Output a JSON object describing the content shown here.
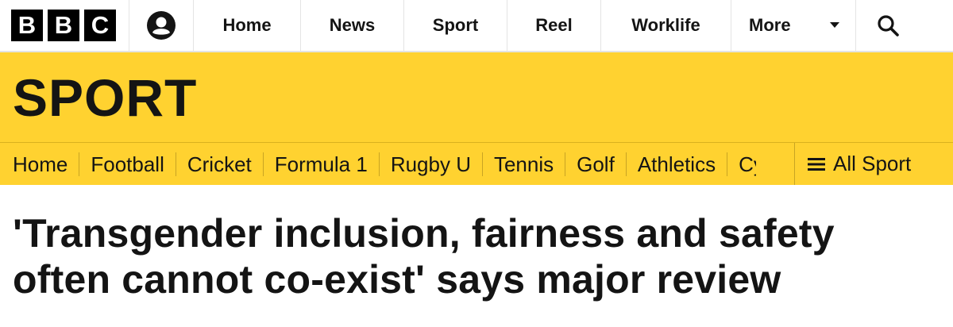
{
  "topbar": {
    "logo_letters": [
      "B",
      "B",
      "C"
    ],
    "account_icon": "user-icon",
    "nav": [
      {
        "label": "Home"
      },
      {
        "label": "News"
      },
      {
        "label": "Sport"
      },
      {
        "label": "Reel"
      },
      {
        "label": "Worklife"
      }
    ],
    "more_label": "More",
    "more_icon": "chevron-down-icon",
    "search_icon": "search-icon"
  },
  "masthead": {
    "title": "SPORT",
    "background": "#ffd230"
  },
  "subnav": {
    "items": [
      {
        "label": "Home"
      },
      {
        "label": "Football"
      },
      {
        "label": "Cricket"
      },
      {
        "label": "Formula 1"
      },
      {
        "label": "Rugby U"
      },
      {
        "label": "Tennis"
      },
      {
        "label": "Golf"
      },
      {
        "label": "Athletics"
      },
      {
        "label": "Cy"
      }
    ],
    "all_sport_label": "All Sport",
    "all_sport_icon": "menu-icon"
  },
  "article": {
    "headline": "'Transgender inclusion, fairness and safety often cannot co-exist' says major review"
  }
}
